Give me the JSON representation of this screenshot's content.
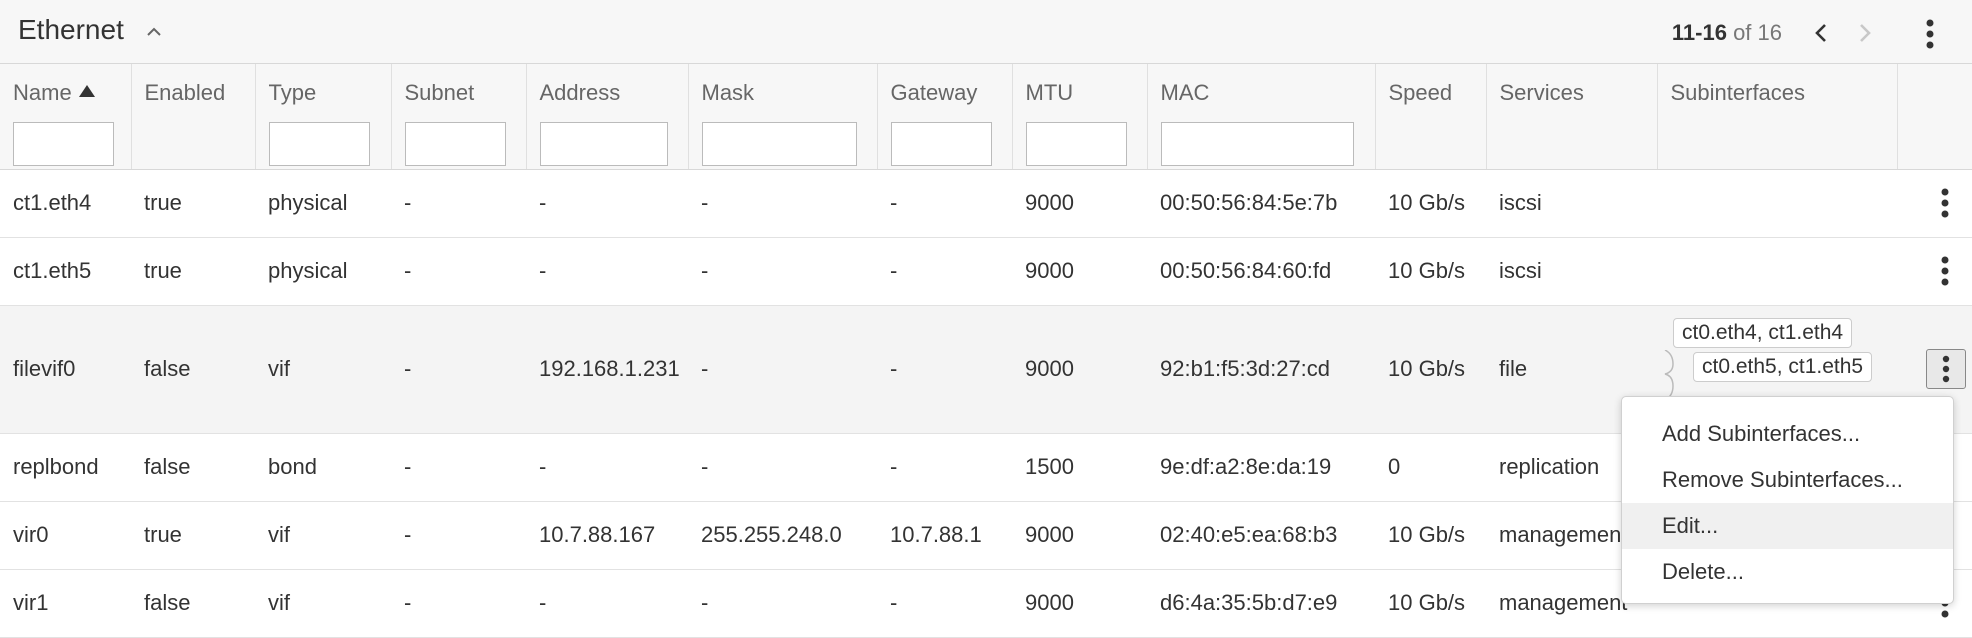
{
  "panel": {
    "title": "Ethernet",
    "pager": {
      "range": "11-16",
      "of_label": "of 16"
    }
  },
  "columns": [
    {
      "key": "name",
      "label": "Name",
      "filter": true,
      "sorted": "asc"
    },
    {
      "key": "enabled",
      "label": "Enabled",
      "filter": false
    },
    {
      "key": "type",
      "label": "Type",
      "filter": true
    },
    {
      "key": "subnet",
      "label": "Subnet",
      "filter": true
    },
    {
      "key": "address",
      "label": "Address",
      "filter": true
    },
    {
      "key": "mask",
      "label": "Mask",
      "filter": true
    },
    {
      "key": "gateway",
      "label": "Gateway",
      "filter": true
    },
    {
      "key": "mtu",
      "label": "MTU",
      "filter": true
    },
    {
      "key": "mac",
      "label": "MAC",
      "filter": true
    },
    {
      "key": "speed",
      "label": "Speed",
      "filter": false
    },
    {
      "key": "services",
      "label": "Services",
      "filter": false
    },
    {
      "key": "subinterfaces",
      "label": "Subinterfaces",
      "filter": false
    }
  ],
  "filters": {
    "name": "",
    "type": "",
    "subnet": "",
    "address": "",
    "mask": "",
    "gateway": "",
    "mtu": "",
    "mac": ""
  },
  "rows": [
    {
      "name": "ct1.eth4",
      "enabled": "true",
      "type": "physical",
      "subnet": "-",
      "address": "-",
      "mask": "-",
      "gateway": "-",
      "mtu": "9000",
      "mac": "00:50:56:84:5e:7b",
      "speed": "10 Gb/s",
      "services": "iscsi",
      "subinterfaces": []
    },
    {
      "name": "ct1.eth5",
      "enabled": "true",
      "type": "physical",
      "subnet": "-",
      "address": "-",
      "mask": "-",
      "gateway": "-",
      "mtu": "9000",
      "mac": "00:50:56:84:60:fd",
      "speed": "10 Gb/s",
      "services": "iscsi",
      "subinterfaces": []
    },
    {
      "name": "filevif0",
      "enabled": "false",
      "type": "vif",
      "subnet": "-",
      "address": "192.168.1.231",
      "mask": "-",
      "gateway": "-",
      "mtu": "9000",
      "mac": "92:b1:f5:3d:27:cd",
      "speed": "10 Gb/s",
      "services": "file",
      "subinterfaces": [
        "ct0.eth4, ct1.eth4",
        "ct0.eth5, ct1.eth5"
      ]
    },
    {
      "name": "replbond",
      "enabled": "false",
      "type": "bond",
      "subnet": "-",
      "address": "-",
      "mask": "-",
      "gateway": "-",
      "mtu": "1500",
      "mac": "9e:df:a2:8e:da:19",
      "speed": "0",
      "services": "replication",
      "subinterfaces": []
    },
    {
      "name": "vir0",
      "enabled": "true",
      "type": "vif",
      "subnet": "-",
      "address": "10.7.88.167",
      "mask": "255.255.248.0",
      "gateway": "10.7.88.1",
      "mtu": "9000",
      "mac": "02:40:e5:ea:68:b3",
      "speed": "10 Gb/s",
      "services": "management",
      "subinterfaces": []
    },
    {
      "name": "vir1",
      "enabled": "false",
      "type": "vif",
      "subnet": "-",
      "address": "-",
      "mask": "-",
      "gateway": "-",
      "mtu": "9000",
      "mac": "d6:4a:35:5b:d7:e9",
      "speed": "10 Gb/s",
      "services": "management",
      "subinterfaces": []
    }
  ],
  "context_menu": {
    "items": [
      "Add Subinterfaces...",
      "Remove Subinterfaces...",
      "Edit...",
      "Delete..."
    ],
    "hovered": "Edit..."
  },
  "icons": {
    "collapse": "chevron-up-icon",
    "prev": "chevron-left-icon",
    "next": "chevron-right-icon",
    "more": "kebab-menu-icon",
    "sort": "sort-ascending-icon"
  },
  "colors": {
    "header_bg": "#f7f7f7",
    "selected_row_bg": "#f4f4f4",
    "text": "#333333",
    "muted": "#777777"
  }
}
